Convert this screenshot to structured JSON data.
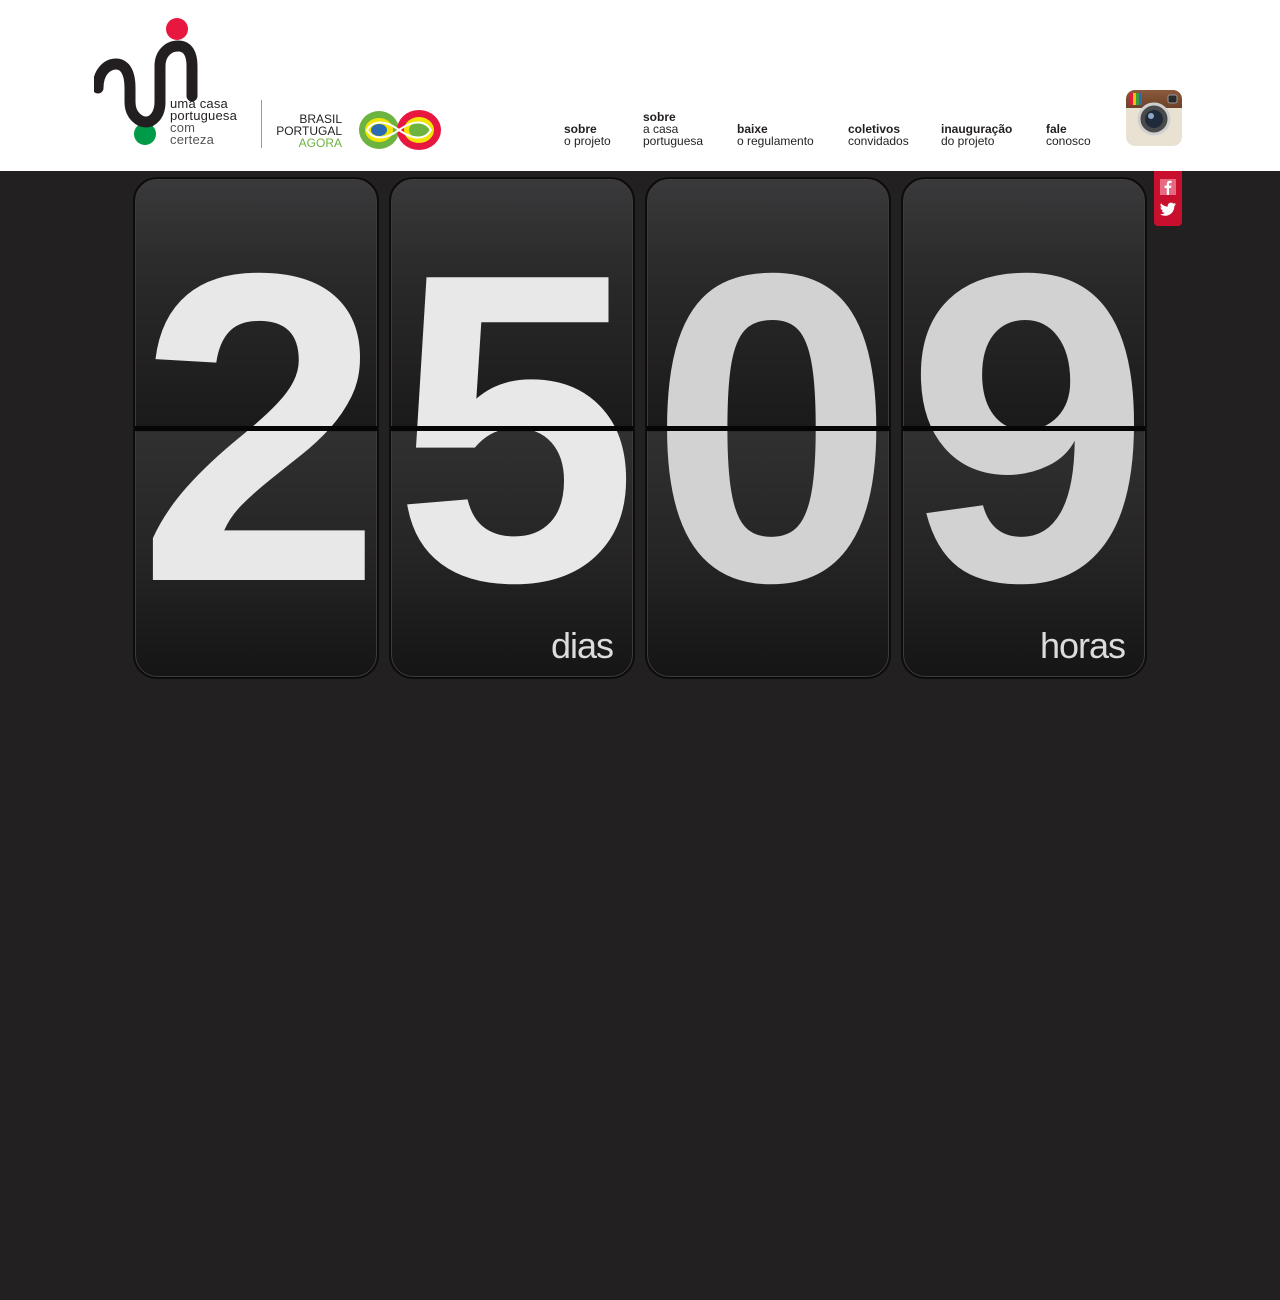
{
  "brand": {
    "line1": "uma casa",
    "line2": "portuguesa",
    "line3": "com",
    "line4": "certeza",
    "partner_line1": "BRASIL",
    "partner_line2": "PORTUGAL",
    "partner_line3": "AGORA"
  },
  "nav": [
    {
      "bold": "sobre",
      "regular": "o projeto"
    },
    {
      "bold": "sobre",
      "regular": "a casa portuguesa"
    },
    {
      "bold": "baixe",
      "regular": "o regulamento"
    },
    {
      "bold": "coletivos",
      "regular": "convidados"
    },
    {
      "bold": "inauguração",
      "regular": "do projeto"
    },
    {
      "bold": "fale",
      "regular": "conosco"
    }
  ],
  "social": {
    "icons": [
      "instagram-icon",
      "facebook-icon",
      "twitter-icon"
    ]
  },
  "counter": {
    "digits": [
      "2",
      "5",
      "0",
      "9"
    ],
    "days_label": "dias",
    "hours_label": "horas"
  },
  "colors": {
    "background": "#232021",
    "accent_red": "#c8102e",
    "brand_red": "#e8173f",
    "brand_green": "#009b48",
    "agora_green": "#6db33f"
  }
}
